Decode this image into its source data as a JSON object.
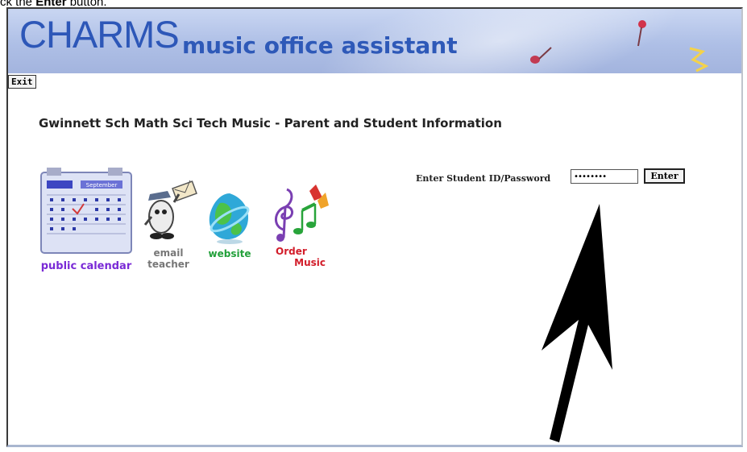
{
  "instruction": {
    "prefix": "ck the ",
    "bold": "Enter",
    "suffix": " button."
  },
  "banner": {
    "logo_text": "CHARMS",
    "subtitle": "music office assistant"
  },
  "toolbar": {
    "exit_label": "Exit"
  },
  "page": {
    "title": "Gwinnett Sch Math Sci Tech Music - Parent and Student Information"
  },
  "tiles": {
    "calendar": {
      "label": "public calendar",
      "month": "September"
    },
    "email": {
      "line1": "email",
      "line2": "teacher"
    },
    "website": {
      "label": "website"
    },
    "order": {
      "line1": "Order",
      "line2": "Music"
    }
  },
  "login": {
    "label": "Enter Student ID/Password",
    "value": "••••••••",
    "enter_label": "Enter"
  },
  "colors": {
    "logo": "#2d57b8",
    "banner": "#aebfe6",
    "calendar_label": "#7a2ad6",
    "website_label": "#22a03a",
    "order_label": "#d21d2a"
  }
}
